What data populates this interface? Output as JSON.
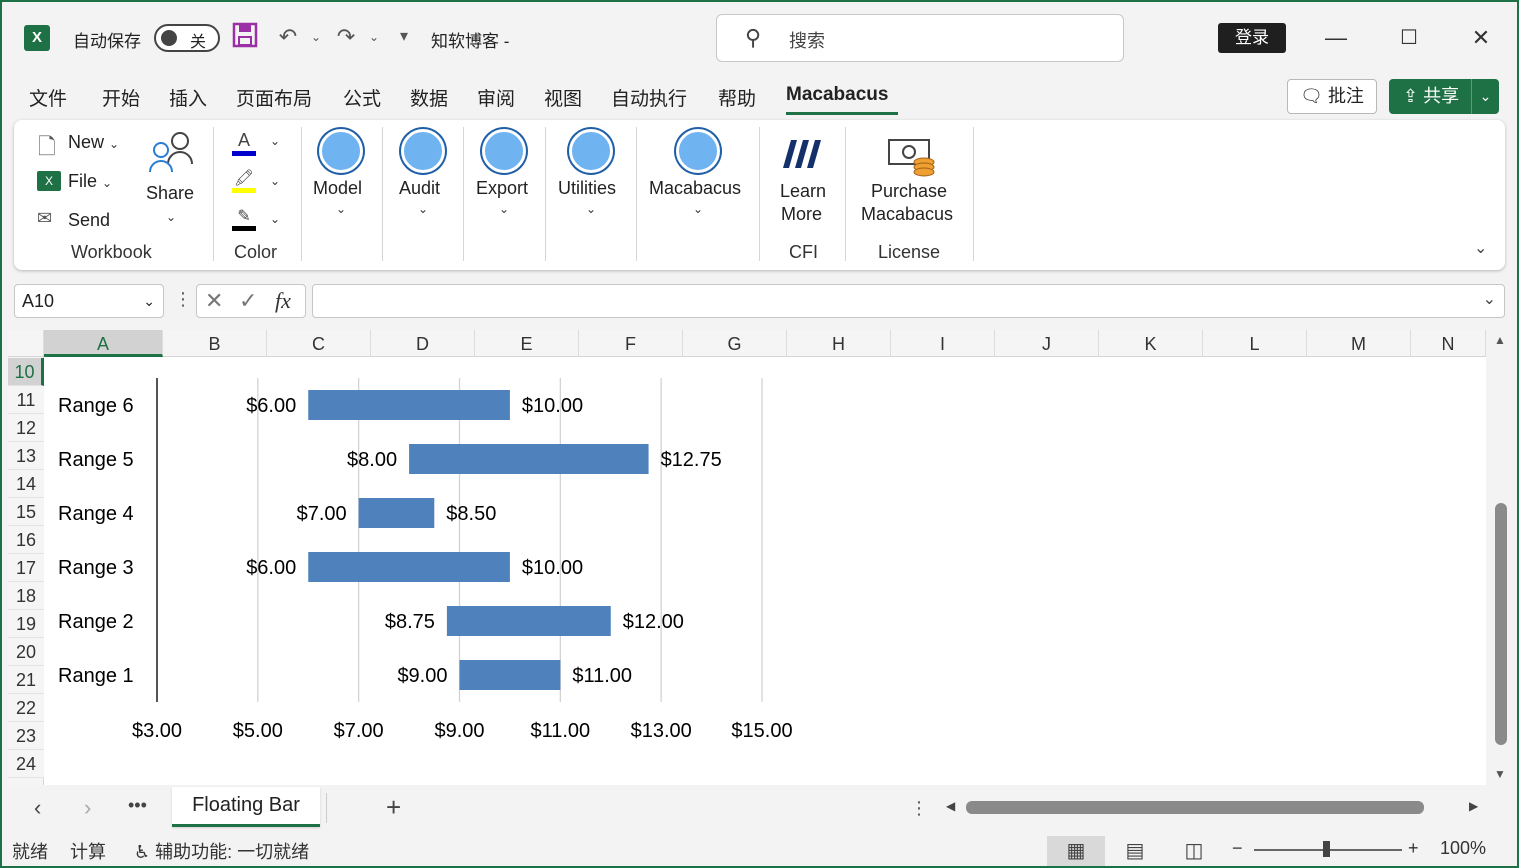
{
  "titlebar": {
    "app_logo": "X",
    "autosave_label": "自动保存",
    "autosave_state": "关",
    "doc_title": "知软博客  -",
    "search_placeholder": "搜索",
    "login_label": "登录",
    "icons": [
      "save-icon",
      "undo-icon",
      "redo-icon",
      "customize-icon",
      "minimize-icon",
      "maximize-icon",
      "close-icon"
    ]
  },
  "menu": {
    "items": [
      "文件",
      "开始",
      "插入",
      "页面布局",
      "公式",
      "数据",
      "审阅",
      "视图",
      "自动执行",
      "帮助",
      "Macabacus"
    ],
    "active": "Macabacus",
    "comment_label": "批注",
    "share_label": "共享"
  },
  "ribbon": {
    "workbook": {
      "new": "New",
      "file": "File",
      "send": "Send",
      "share": "Share",
      "group_label": "Workbook"
    },
    "color": {
      "group_label": "Color"
    },
    "buttons": [
      "Model",
      "Audit",
      "Export",
      "Utilities",
      "Macabacus"
    ],
    "cfi": {
      "line1": "Learn",
      "line2": "More",
      "group_label": "CFI"
    },
    "license": {
      "line1": "Purchase",
      "line2": "Macabacus",
      "group_label": "License"
    }
  },
  "formula_bar": {
    "namebox": "A10",
    "fx": "fx",
    "formula": ""
  },
  "grid": {
    "columns": [
      "A",
      "B",
      "C",
      "D",
      "E",
      "F",
      "G",
      "H",
      "I",
      "J",
      "K",
      "L",
      "M",
      "N"
    ],
    "selected_column": "A",
    "rows": [
      "10",
      "11",
      "12",
      "13",
      "14",
      "15",
      "16",
      "17",
      "18",
      "19",
      "20",
      "21",
      "22",
      "23",
      "24"
    ],
    "selected_row": "10"
  },
  "chart_data": {
    "type": "bar",
    "subtype": "floating-bar",
    "categories": [
      "Range 6",
      "Range 5",
      "Range 4",
      "Range 3",
      "Range 2",
      "Range 1"
    ],
    "low": [
      6.0,
      8.0,
      7.0,
      6.0,
      8.75,
      9.0
    ],
    "high": [
      10.0,
      12.75,
      8.5,
      10.0,
      12.0,
      11.0
    ],
    "low_labels": [
      "$6.00",
      "$8.00",
      "$7.00",
      "$6.00",
      "$8.75",
      "$9.00"
    ],
    "high_labels": [
      "$10.00",
      "$12.75",
      "$8.50",
      "$10.00",
      "$12.00",
      "$11.00"
    ],
    "xticks": [
      3,
      5,
      7,
      9,
      11,
      13,
      15
    ],
    "xtick_labels": [
      "$3.00",
      "$5.00",
      "$7.00",
      "$9.00",
      "$11.00",
      "$13.00",
      "$15.00"
    ],
    "xlim": [
      3,
      15
    ],
    "bar_color": "#4f81bd",
    "grid": true
  },
  "sheets": {
    "tabs": [
      "Floating Bar"
    ],
    "active": "Floating Bar"
  },
  "status": {
    "ready": "就绪",
    "calc": "计算",
    "accessibility": "辅助功能: 一切就绪",
    "zoom": "100%"
  }
}
